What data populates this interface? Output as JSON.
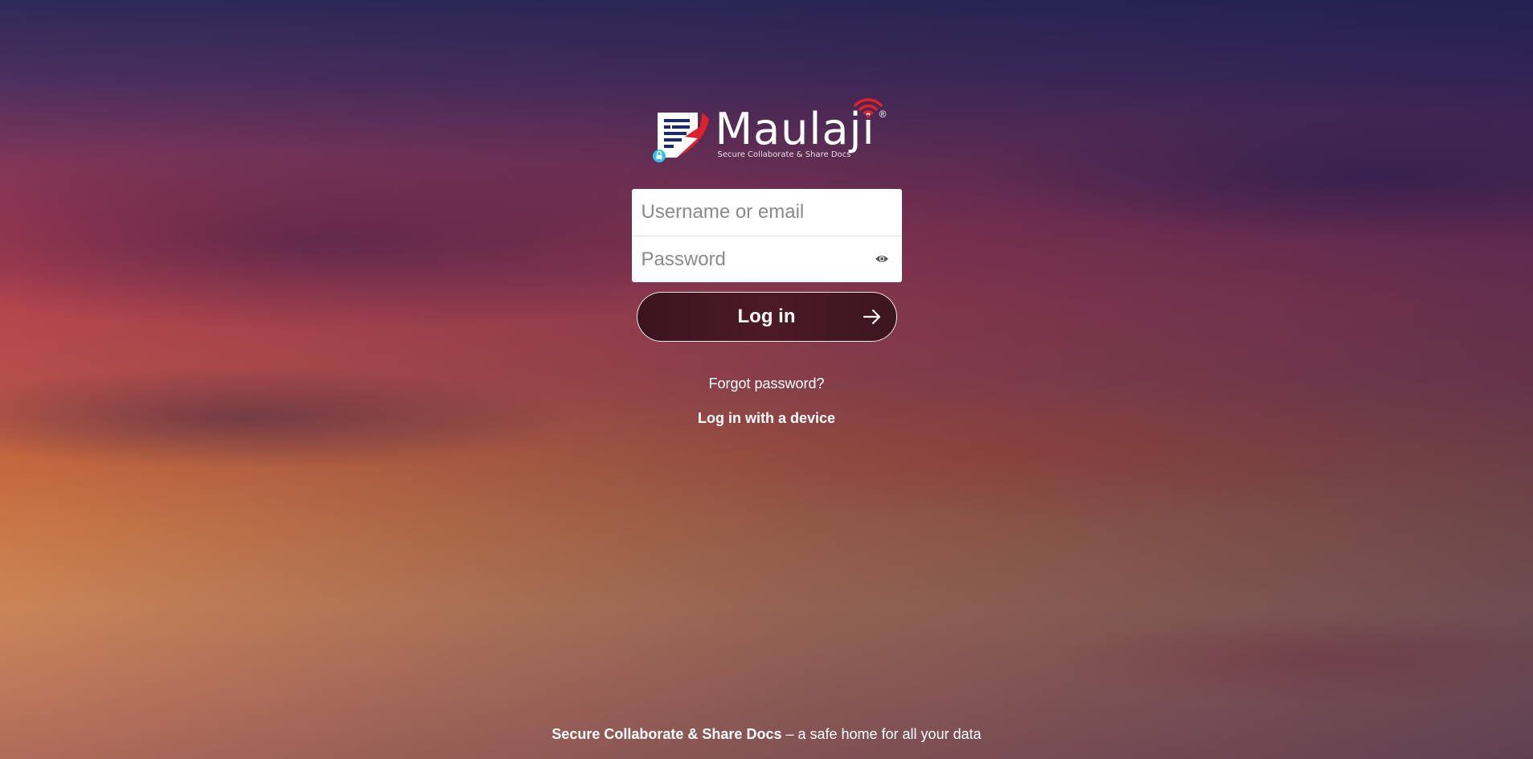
{
  "brand": {
    "name": "Maulaji",
    "tagline": "Secure Collaborate & Share Docs",
    "registered": "®"
  },
  "login": {
    "username_placeholder": "Username or email",
    "username_value": "",
    "password_placeholder": "Password",
    "password_value": "",
    "submit_label": "Log in",
    "forgot_password": "Forgot password?",
    "device_login": "Log in with a device"
  },
  "footer": {
    "bold": "Secure Collaborate & Share Docs",
    "rest": " – a safe home for all your data"
  },
  "icons": {
    "eye": "eye-icon",
    "arrow": "arrow-right-icon"
  },
  "colors": {
    "button_bg": "#4c1a25",
    "logo_red": "#e0202a",
    "logo_navy": "#1c2a6b",
    "lock_cyan": "#31c4e8"
  }
}
